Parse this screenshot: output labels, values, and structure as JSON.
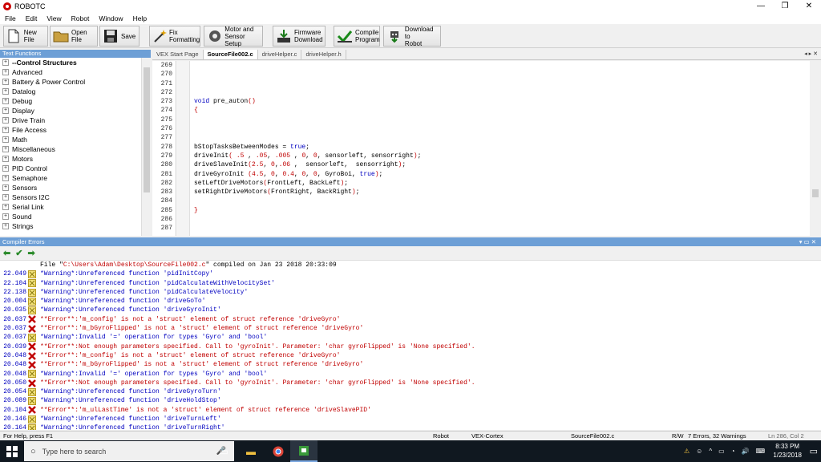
{
  "window": {
    "title": "ROBOTC",
    "minimize": "—",
    "maximize": "❐",
    "close": "✕"
  },
  "menu": [
    "File",
    "Edit",
    "View",
    "Robot",
    "Window",
    "Help"
  ],
  "toolbar": {
    "new_file": "New File",
    "open_file": "Open File",
    "save": "Save",
    "fix_formatting_1": "Fix",
    "fix_formatting_2": "Formatting",
    "pid_1": "Motor and",
    "pid_2": "Sensor Setup",
    "firmware_1": "Firmware",
    "firmware_2": "Download",
    "compile_1": "Compile",
    "compile_2": "Program",
    "download_1": "Download to",
    "download_2": "Robot"
  },
  "text_functions": {
    "header": "Text Functions",
    "items": [
      "--Control Structures",
      "Advanced",
      "Battery & Power Control",
      "Datalog",
      "Debug",
      "Display",
      "Drive Train",
      "File Access",
      "Math",
      "Miscellaneous",
      "Motors",
      "PID Control",
      "Semaphore",
      "Sensors",
      "Sensors I2C",
      "Serial Link",
      "Sound",
      "Strings"
    ]
  },
  "tabs": {
    "items": [
      "VEX Start Page",
      "SourceFile002.c",
      "driveHelper.c",
      "driveHelper.h"
    ],
    "active_index": 1,
    "controls": "◂ ▸ ✕"
  },
  "editor": {
    "line_numbers": [
      "269",
      "270",
      "271",
      "272",
      "273",
      "274",
      "275",
      "276",
      "277",
      "278",
      "279",
      "280",
      "281",
      "282",
      "283",
      "284",
      "285",
      "286",
      "287"
    ],
    "lines": [
      "",
      "",
      "",
      "",
      "void pre_auton()",
      "{",
      "",
      "",
      "",
      "bStopTasksBetweenModes = true;",
      "driveInit( .5 , .05, .005 , 0, 0, sensorleft, sensorright);",
      "driveSlaveInit(2.5, 0,.06 ,  sensorleft,  sensorright);",
      "driveGyroInit (4.5, 0, 0.4, 0, 0, GyroBoi, true);",
      "setLeftDriveMotors(FrontLeft, BackLeft);",
      "setRightDriveMotors(FrontRight, BackRight);",
      "",
      "}",
      "",
      ""
    ]
  },
  "compiler_errors": {
    "header": "Compiler Errors",
    "header_controls": "▾ ▭ ✕",
    "toolbar_icons": [
      "back-arrow-icon",
      "check-icon",
      "forward-arrow-icon"
    ],
    "rows": [
      {
        "time": "",
        "kind": "info",
        "text": "File \"",
        "path": "C:\\Users\\Adam\\Desktop\\SourceFile002.c",
        "rest": "\" compiled on Jan 23 2018 20:33:09"
      },
      {
        "time": "22.049",
        "kind": "warn",
        "text": "*Warning*:Unreferenced function 'pidInitCopy'"
      },
      {
        "time": "22.104",
        "kind": "warn",
        "text": "*Warning*:Unreferenced function 'pidCalculateWithVelocitySet'"
      },
      {
        "time": "22.138",
        "kind": "warn",
        "text": "*Warning*:Unreferenced function 'pidCalculateVelocity'"
      },
      {
        "time": "20.004",
        "kind": "warn",
        "text": "*Warning*:Unreferenced function 'driveGoTo'"
      },
      {
        "time": "20.035",
        "kind": "warn",
        "text": "*Warning*:Unreferenced function 'driveGyroInit'"
      },
      {
        "time": "20.037",
        "kind": "err",
        "text": "**Error**:'m_config' is not a 'struct' element of struct reference 'driveGyro'"
      },
      {
        "time": "20.037",
        "kind": "err",
        "text": "**Error**:'m_bGyroFlipped' is not a 'struct' element of struct reference 'driveGyro'"
      },
      {
        "time": "20.037",
        "kind": "warn",
        "text": "*Warning*:Invalid '=' operation for types 'Gyro' and 'bool'"
      },
      {
        "time": "20.039",
        "kind": "err",
        "text": "**Error**:Not enough parameters specified. Call to 'gyroInit'. Parameter: 'char gyroFlipped' is 'None specified'."
      },
      {
        "time": "20.048",
        "kind": "err",
        "text": "**Error**:'m_config' is not a 'struct' element of struct reference 'driveGyro'"
      },
      {
        "time": "20.048",
        "kind": "err",
        "text": "**Error**:'m_bGyroFlipped' is not a 'struct' element of struct reference 'driveGyro'"
      },
      {
        "time": "20.048",
        "kind": "warn",
        "text": "*Warning*:Invalid '=' operation for types 'Gyro' and 'bool'"
      },
      {
        "time": "20.050",
        "kind": "err",
        "text": "**Error**:Not enough parameters specified. Call to 'gyroInit'. Parameter: 'char gyroFlipped' is 'None specified'."
      },
      {
        "time": "20.054",
        "kind": "warn",
        "text": "*Warning*:Unreferenced function 'driveGyroTurn'"
      },
      {
        "time": "20.089",
        "kind": "warn",
        "text": "*Warning*:Unreferenced function 'driveHoldStop'"
      },
      {
        "time": "20.104",
        "kind": "err",
        "text": "**Error**:'m_ulLastTime' is not a 'struct' element of struct reference 'driveSlavePID'"
      },
      {
        "time": "20.146",
        "kind": "warn",
        "text": "*Warning*:Unreferenced function 'driveTurnLeft'"
      },
      {
        "time": "20.164",
        "kind": "warn",
        "text": "*Warning*:Unreferenced function 'driveTurnRight'"
      }
    ]
  },
  "statusbar": {
    "help": "For Help, press F1",
    "robot": "Robot",
    "platform": "VEX-Cortex",
    "file": "SourceFile002.c",
    "mode": "R/W",
    "counts": "7 Errors, 32 Warnings",
    "position": "Ln 286, Col 2"
  },
  "taskbar": {
    "search_placeholder": "Type here to search",
    "time": "8:33 PM",
    "date": "1/23/2018"
  },
  "colors": {
    "panel_header": "#6d9fd6",
    "keyword": "#0000c0",
    "error": "#c00000",
    "taskbar": "#101820"
  }
}
